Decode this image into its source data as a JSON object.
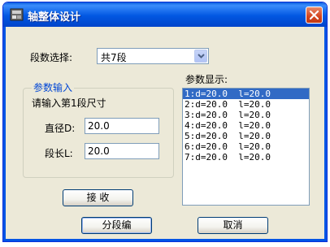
{
  "window": {
    "title": "轴整体设计"
  },
  "segments": {
    "label": "段数选择:",
    "selected": "共7段"
  },
  "param_input": {
    "group_title": "参数输入",
    "prompt": "请输入第1段尺寸",
    "diameter_label": "直径D:",
    "diameter_value": "20.0",
    "length_label": "段长L:",
    "length_value": "20.0"
  },
  "param_display": {
    "label": "参数显示:",
    "items": [
      "1:d=20.0  l=20.0",
      "2:d=20.0  l=20.0",
      "3:d=20.0  l=20.0",
      "4:d=20.0  l=20.0",
      "5:d=20.0  l=20.0",
      "6:d=20.0  l=20.0",
      "7:d=20.0  l=20.0"
    ]
  },
  "buttons": {
    "receive": "接 收",
    "segment_edit": "分段编",
    "cancel": "取消"
  }
}
